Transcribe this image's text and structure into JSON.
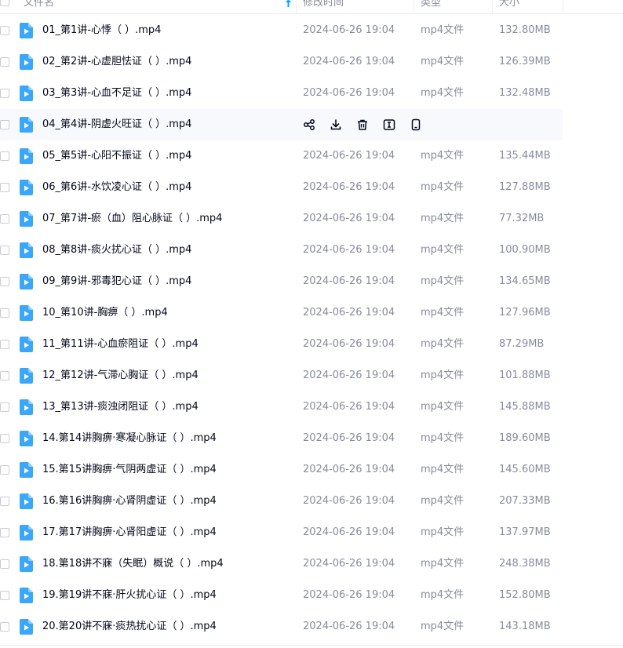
{
  "header": {
    "name_label": "文件名",
    "modified_label": "修改时间",
    "type_label": "类型",
    "size_label": "大小"
  },
  "colors": {
    "accent": "#06a7ff",
    "text_primary": "#03081a",
    "text_secondary": "#878c9c",
    "hover_bg": "#f7f9fc"
  },
  "hover_actions": [
    "share-icon",
    "download-icon",
    "delete-icon",
    "rename-icon",
    "phone-icon"
  ],
  "files": [
    {
      "name": "01_第1讲-心悸（ ）.mp4",
      "modified": "2024-06-26 19:04",
      "type": "mp4文件",
      "size": "132.80MB"
    },
    {
      "name": "02_第2讲-心虚胆怯证（ ）.mp4",
      "modified": "2024-06-26 19:04",
      "type": "mp4文件",
      "size": "126.39MB"
    },
    {
      "name": "03_第3讲-心血不足证（ ）.mp4",
      "modified": "2024-06-26 19:04",
      "type": "mp4文件",
      "size": "132.48MB"
    },
    {
      "name": "04_第4讲-阴虚火旺证（ ）.mp4",
      "modified": "",
      "type": "",
      "size": "",
      "hovered": true
    },
    {
      "name": "05_第5讲-心阳不振证（ ）.mp4",
      "modified": "2024-06-26 19:04",
      "type": "mp4文件",
      "size": "135.44MB"
    },
    {
      "name": "06_第6讲-水饮凌心证（ ）.mp4",
      "modified": "2024-06-26 19:04",
      "type": "mp4文件",
      "size": "127.88MB"
    },
    {
      "name": "07_第7讲-瘀（血）阻心脉证（ ）.mp4",
      "modified": "2024-06-26 19:04",
      "type": "mp4文件",
      "size": "77.32MB"
    },
    {
      "name": "08_第8讲-痰火扰心证（ ）.mp4",
      "modified": "2024-06-26 19:04",
      "type": "mp4文件",
      "size": "100.90MB"
    },
    {
      "name": "09_第9讲-邪毒犯心证（ ）.mp4",
      "modified": "2024-06-26 19:04",
      "type": "mp4文件",
      "size": "134.65MB"
    },
    {
      "name": "10_第10讲-胸痹（ ）.mp4",
      "modified": "2024-06-26 19:04",
      "type": "mp4文件",
      "size": "127.96MB"
    },
    {
      "name": "11_第11讲-心血瘀阻证（ ）.mp4",
      "modified": "2024-06-26 19:04",
      "type": "mp4文件",
      "size": "87.29MB"
    },
    {
      "name": "12_第12讲-气滞心胸证（ ）.mp4",
      "modified": "2024-06-26 19:04",
      "type": "mp4文件",
      "size": "101.88MB"
    },
    {
      "name": "13_第13讲-痰浊闭阻证（ ）.mp4",
      "modified": "2024-06-26 19:04",
      "type": "mp4文件",
      "size": "145.88MB"
    },
    {
      "name": "14.第14讲胸痹·寒凝心脉证（ ）.mp4",
      "modified": "2024-06-26 19:04",
      "type": "mp4文件",
      "size": "189.60MB"
    },
    {
      "name": "15.第15讲胸痹·气阴两虚证（ ）.mp4",
      "modified": "2024-06-26 19:04",
      "type": "mp4文件",
      "size": "145.60MB"
    },
    {
      "name": "16.第16讲胸痹·心肾阴虚证（ ）.mp4",
      "modified": "2024-06-26 19:04",
      "type": "mp4文件",
      "size": "207.33MB"
    },
    {
      "name": "17.第17讲胸痹·心肾阳虚证（ ）.mp4",
      "modified": "2024-06-26 19:04",
      "type": "mp4文件",
      "size": "137.97MB"
    },
    {
      "name": "18.第18讲不寐（失眠）概说（ ）.mp4",
      "modified": "2024-06-26 19:04",
      "type": "mp4文件",
      "size": "248.38MB"
    },
    {
      "name": "19.第19讲不寐·肝火扰心证（ ）.mp4",
      "modified": "2024-06-26 19:04",
      "type": "mp4文件",
      "size": "152.80MB"
    },
    {
      "name": "20.第20讲不寐·痰热扰心证（ ）.mp4",
      "modified": "2024-06-26 19:04",
      "type": "mp4文件",
      "size": "143.18MB"
    }
  ]
}
